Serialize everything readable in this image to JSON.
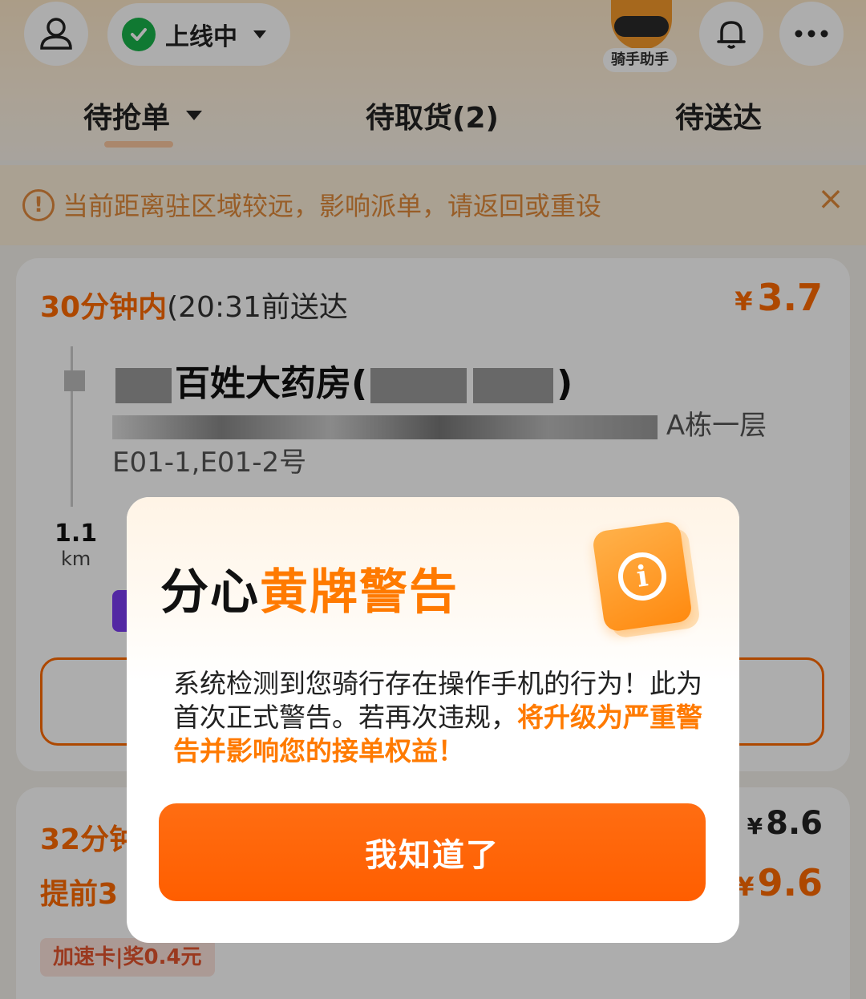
{
  "header": {
    "status_label": "上线中",
    "assistant_label": "骑手助手"
  },
  "tabs": [
    {
      "label": "待抢单"
    },
    {
      "label": "待取货(2)"
    },
    {
      "label": "待送达"
    }
  ],
  "notice": {
    "text": "当前距离驻区域较远，影响派单，请返回或重设"
  },
  "orders": [
    {
      "time_highlight": "30分钟内",
      "time_rest": "(20:31前送达",
      "price_symbol": "¥",
      "price": "3.7",
      "shop_visible": "百姓大药房(",
      "shop_end": ")",
      "address_end": "A栋一层",
      "address_line2": "E01-1,E01-2号",
      "distance": "1.1",
      "distance_unit": "km"
    },
    {
      "time_highlight": "32分钟",
      "early_label": "提前3",
      "price_symbol": "¥",
      "price": "8.6",
      "bonus_price": "9.6",
      "speed_badge": "加速卡|奖0.4元"
    }
  ],
  "modal": {
    "title_black": "分心",
    "title_orange": "黄牌警告",
    "body_normal": "系统检测到您骑行存在操作手机的行为！此为首次正式警告。若再次违规，",
    "body_highlight": "将升级为严重警告并影响您的接单权益！",
    "button_label": "我知道了"
  },
  "colors": {
    "accent": "#ff6a00",
    "status_green": "#19b34a",
    "title_orange": "#ff7a00"
  }
}
